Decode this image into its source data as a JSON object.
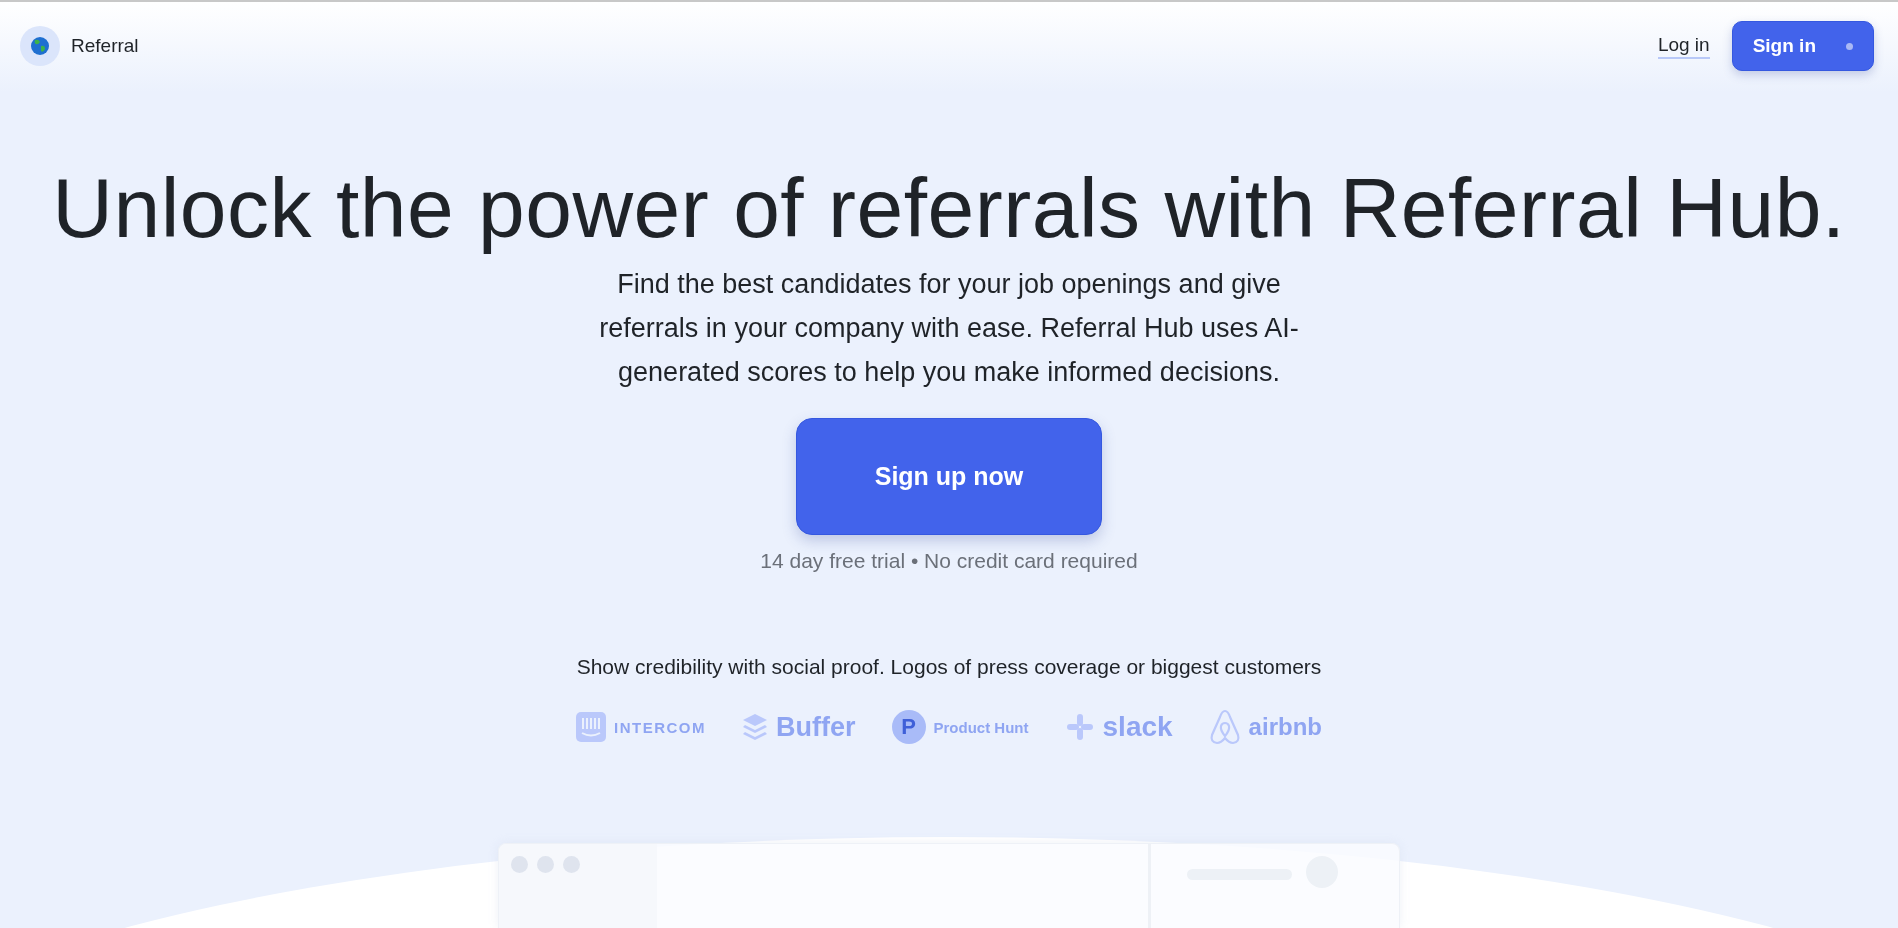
{
  "nav": {
    "brand": "Referral",
    "login": "Log in",
    "signin": "Sign in"
  },
  "hero": {
    "headline": "Unlock the power of referrals with Referral Hub.",
    "lead": "Find the best candidates for your job openings and give referrals in your company with ease. Referral Hub uses AI-generated scores to help you make informed decisions.",
    "cta": "Sign up now",
    "note": "14 day free trial • No credit card required"
  },
  "proof": {
    "caption": "Show credibility with social proof. Logos of press coverage or biggest customers",
    "logos": [
      {
        "kind": "intercom",
        "name": "INTERCOM"
      },
      {
        "kind": "buffer",
        "name": "Buffer"
      },
      {
        "kind": "producthunt",
        "name": "Product Hunt",
        "letter": "P"
      },
      {
        "kind": "slack",
        "name": "slack"
      },
      {
        "kind": "airbnb",
        "name": "airbnb"
      }
    ]
  }
}
